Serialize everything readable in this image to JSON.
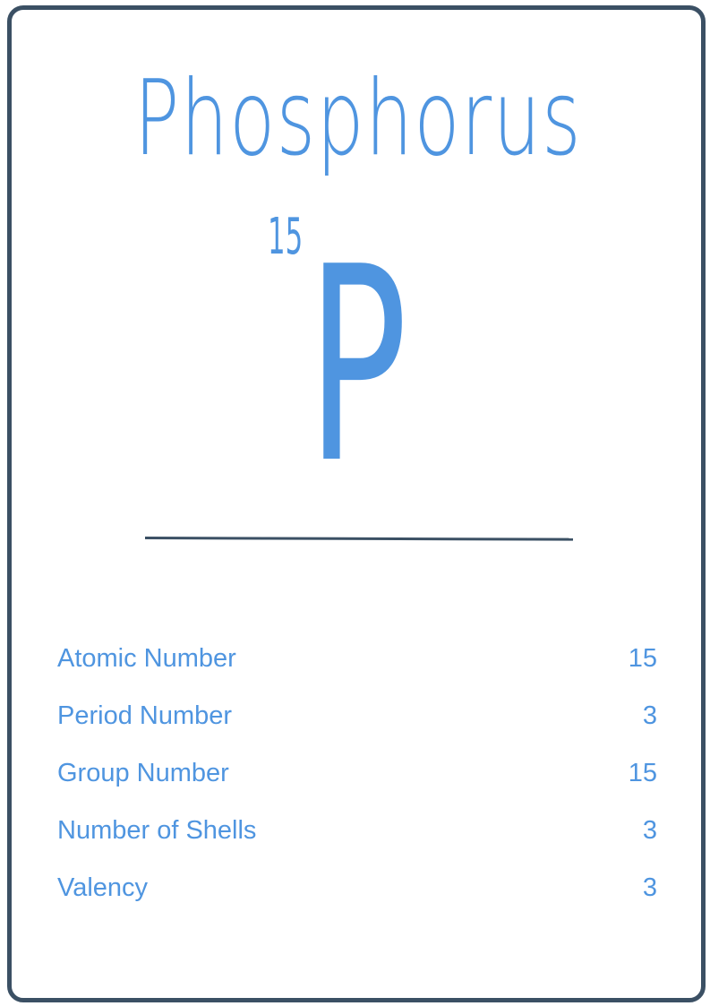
{
  "element": {
    "name": "Phosphorus",
    "atomic_number": "15",
    "symbol": "P"
  },
  "properties": [
    {
      "label": "Atomic Number",
      "value": "15"
    },
    {
      "label": "Period Number",
      "value": "3"
    },
    {
      "label": "Group Number",
      "value": "15"
    },
    {
      "label": "Number of Shells",
      "value": "3"
    },
    {
      "label": "Valency",
      "value": "3"
    }
  ],
  "colors": {
    "accent": "#4f95e0",
    "border": "#3b5064",
    "background": "#ffffff"
  }
}
